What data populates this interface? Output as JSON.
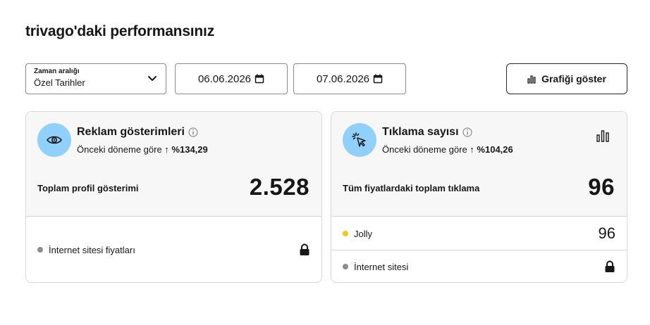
{
  "page": {
    "title": "trivago'daki performansınız"
  },
  "filters": {
    "range_label": "Zaman aralığı",
    "range_value": "Özel Tarihler",
    "start_date": "06.06.2026",
    "end_date": "07.06.2026",
    "show_graph_label": "Grafiği göster"
  },
  "cards": [
    {
      "title": "Reklam gösterimleri",
      "comparison_prefix": "Önceki döneme göre ↑",
      "comparison_value": "%134,29",
      "metric_label": "Toplam profil gösterimi",
      "metric_value": "2.528",
      "rows": [
        {
          "label": "İnternet sitesi fiyatları",
          "dot_color": "#8c8c8c",
          "locked": true
        }
      ]
    },
    {
      "title": "Tıklama sayısı",
      "comparison_prefix": "Önceki döneme göre ↑",
      "comparison_value": "%104,26",
      "metric_label": "Tüm fiyatlardaki toplam tıklama",
      "metric_value": "96",
      "rows": [
        {
          "label": "Jolly",
          "dot_color": "#f5c518",
          "value": "96"
        },
        {
          "label": "İnternet sitesi",
          "dot_color": "#8c8c8c",
          "locked": true
        }
      ]
    }
  ],
  "colors": {
    "accent_circle": "#8fd1fb",
    "card_top_bg": "#f7f7f7",
    "border": "#d8d8d8"
  }
}
